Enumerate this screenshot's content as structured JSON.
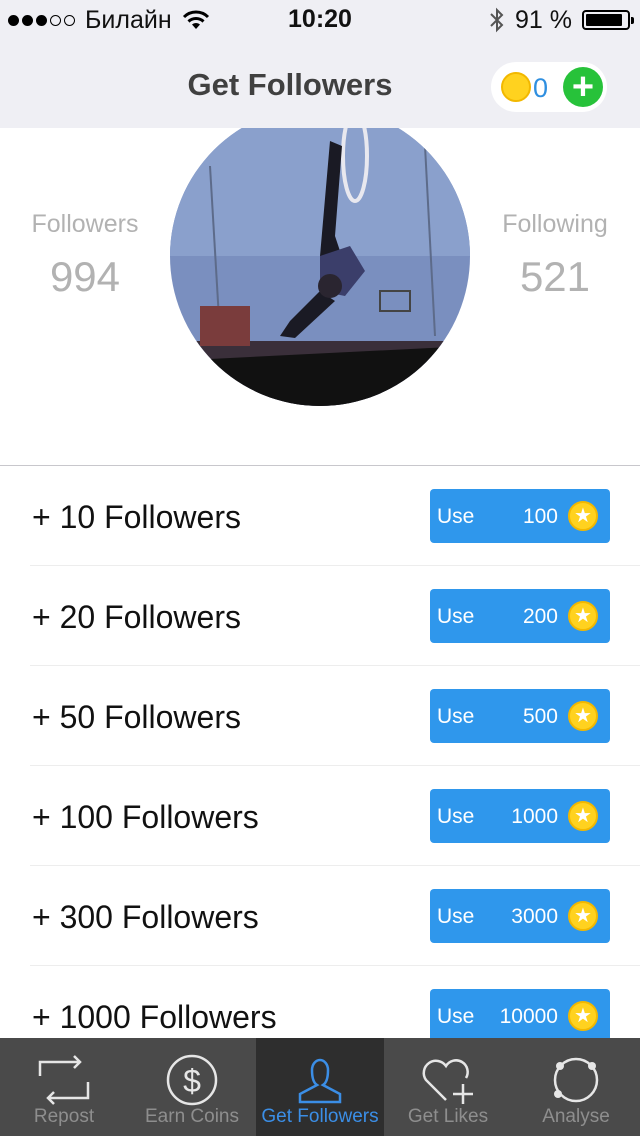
{
  "status_bar": {
    "carrier": "Билайн",
    "time": "10:20",
    "battery": "91 %"
  },
  "nav": {
    "title": "Get Followers",
    "coins": "0"
  },
  "profile": {
    "followers_label": "Followers",
    "followers_value": "994",
    "following_label": "Following",
    "following_value": "521"
  },
  "offers": [
    {
      "label": "+ 10 Followers",
      "button": "Use",
      "cost": "100"
    },
    {
      "label": "+ 20 Followers",
      "button": "Use",
      "cost": "200"
    },
    {
      "label": "+ 50 Followers",
      "button": "Use",
      "cost": "500"
    },
    {
      "label": "+ 100 Followers",
      "button": "Use",
      "cost": "1000"
    },
    {
      "label": "+ 300 Followers",
      "button": "Use",
      "cost": "3000"
    },
    {
      "label": "+ 1000 Followers",
      "button": "Use",
      "cost": "10000"
    }
  ],
  "tabs": [
    {
      "label": "Repost",
      "icon": "repost-icon"
    },
    {
      "label": "Earn Coins",
      "icon": "dollar-icon"
    },
    {
      "label": "Get Followers",
      "icon": "person-icon"
    },
    {
      "label": "Get Likes",
      "icon": "heart-plus-icon"
    },
    {
      "label": "Analyse",
      "icon": "circle-dots-icon"
    }
  ],
  "colors": {
    "accent": "#2f97ec",
    "add_button": "#27c23a",
    "coin": "#ffd21f",
    "tabbar": "#4a4a4a",
    "tab_active": "#3b8ee6"
  }
}
